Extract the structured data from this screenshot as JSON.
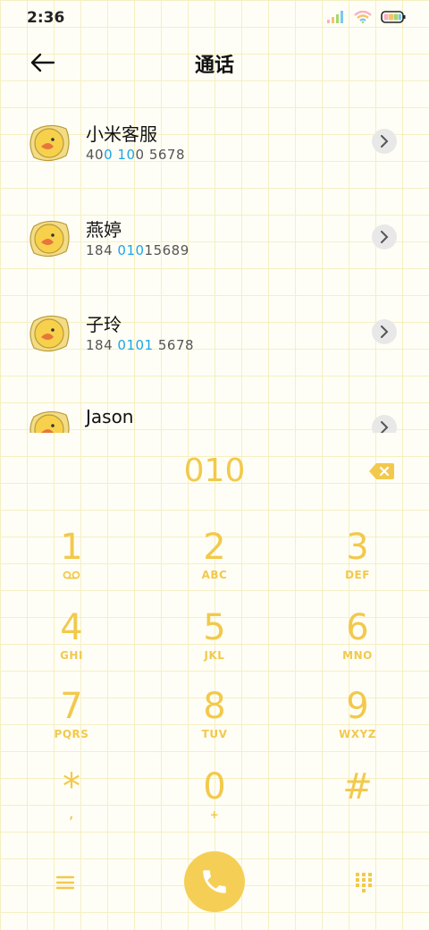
{
  "status_bar": {
    "time": "2:36"
  },
  "header": {
    "title": "通话"
  },
  "contacts": [
    {
      "name": "小米客服",
      "number_pre": "40",
      "number_hl1": "0",
      "number_mid": " ",
      "number_hl2": "10",
      "number_post": "0 5678"
    },
    {
      "name": "燕婷",
      "number_pre": "184 ",
      "number_hl1": "010",
      "number_mid": "",
      "number_hl2": "",
      "number_post": "15689"
    },
    {
      "name": "子玲",
      "number_pre": "184 ",
      "number_hl1": "0101",
      "number_mid": "",
      "number_hl2": "",
      "number_post": " 5678"
    },
    {
      "name": "Jason",
      "number_pre": "",
      "number_hl1": "",
      "number_mid": "",
      "number_hl2": "",
      "number_post": ""
    }
  ],
  "dialpad": {
    "entry": "010",
    "keys": [
      {
        "digit": "1",
        "letters": ""
      },
      {
        "digit": "2",
        "letters": "ABC"
      },
      {
        "digit": "3",
        "letters": "DEF"
      },
      {
        "digit": "4",
        "letters": "GHI"
      },
      {
        "digit": "5",
        "letters": "JKL"
      },
      {
        "digit": "6",
        "letters": "MNO"
      },
      {
        "digit": "7",
        "letters": "PQRS"
      },
      {
        "digit": "8",
        "letters": "TUV"
      },
      {
        "digit": "9",
        "letters": "WXYZ"
      },
      {
        "digit": "*",
        "letters": ","
      },
      {
        "digit": "0",
        "letters": "+"
      },
      {
        "digit": "#",
        "letters": ""
      }
    ]
  },
  "icons": {
    "back": "arrow-left-icon",
    "voicemail": "voicemail-icon",
    "delete": "backspace-icon",
    "menu": "menu-icon",
    "call": "phone-icon",
    "keypad": "dialpad-icon"
  },
  "colors": {
    "accent": "#f2c94c",
    "call_button": "#f5cf55",
    "highlight": "#1aa6e8"
  }
}
